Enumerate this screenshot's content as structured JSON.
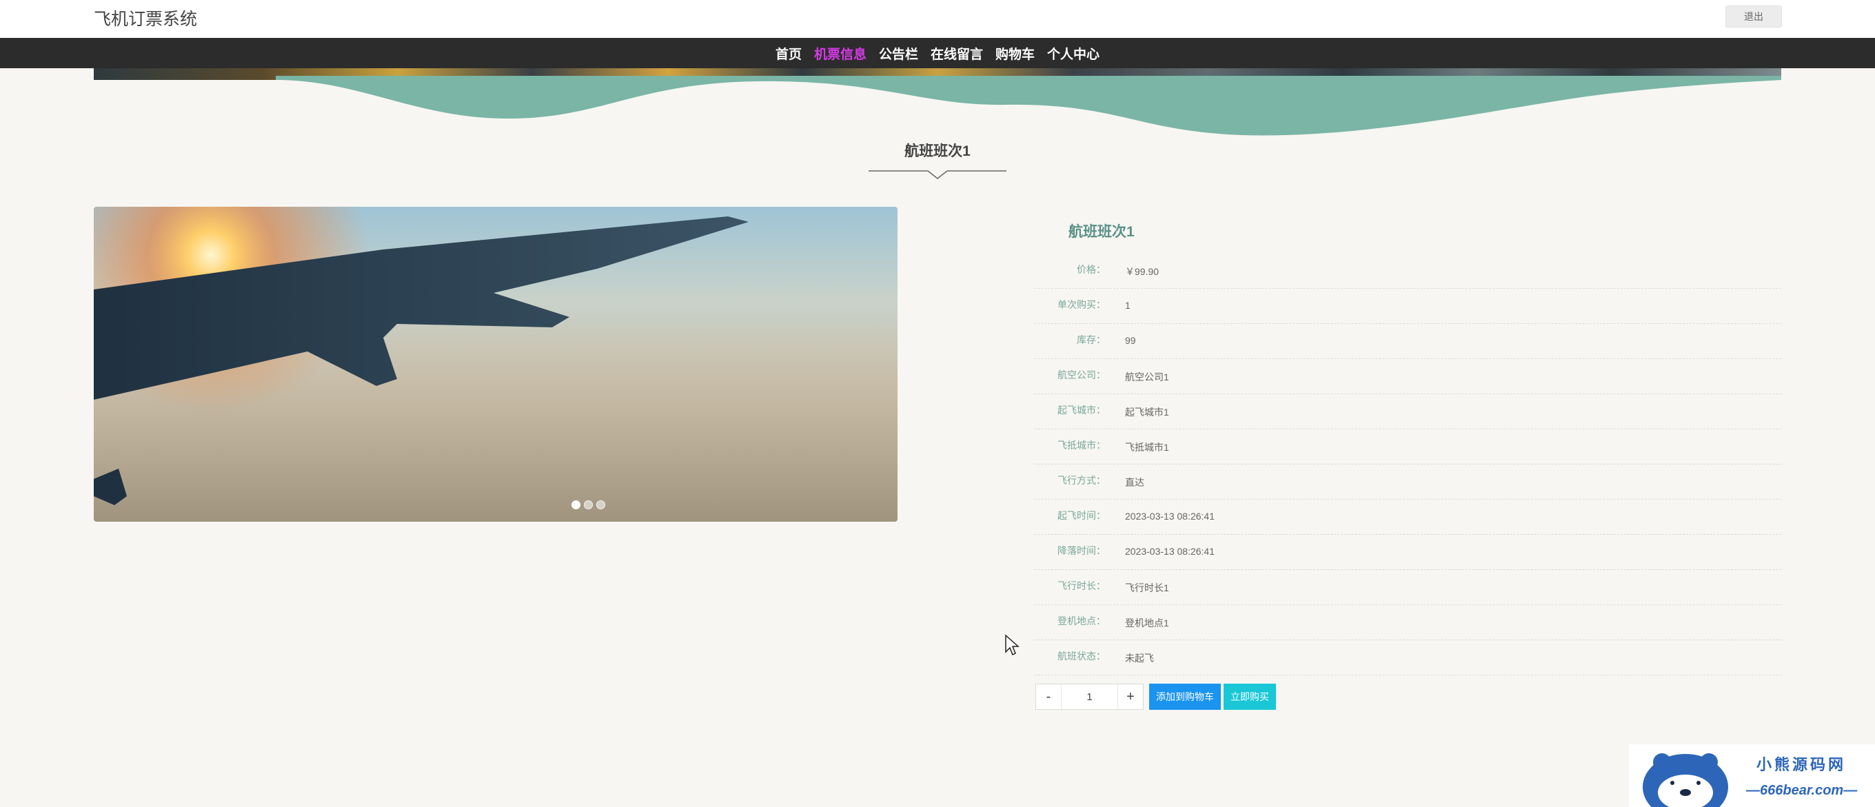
{
  "header": {
    "site_title": "飞机订票系统",
    "logout_label": "退出"
  },
  "nav": {
    "items": [
      {
        "label": "首页"
      },
      {
        "label": "机票信息",
        "active": true
      },
      {
        "label": "公告栏"
      },
      {
        "label": "在线留言"
      },
      {
        "label": "购物车"
      },
      {
        "label": "个人中心"
      }
    ]
  },
  "section": {
    "title": "航班班次1"
  },
  "carousel": {
    "slide_count": 3,
    "active_index": 0
  },
  "detail": {
    "name": "航班班次1",
    "fields": [
      {
        "label": "价格：",
        "value": "￥99.90"
      },
      {
        "label": "单次购买：",
        "value": "1"
      },
      {
        "label": "库存：",
        "value": "99"
      },
      {
        "label": "航空公司：",
        "value": "航空公司1"
      },
      {
        "label": "起飞城市：",
        "value": "起飞城市1"
      },
      {
        "label": "飞抵城市：",
        "value": "飞抵城市1"
      },
      {
        "label": "飞行方式：",
        "value": "直达"
      },
      {
        "label": "起飞时间：",
        "value": "2023-03-13 08:26:41"
      },
      {
        "label": "降落时间：",
        "value": "2023-03-13 08:26:41"
      },
      {
        "label": "飞行时长：",
        "value": "飞行时长1"
      },
      {
        "label": "登机地点：",
        "value": "登机地点1"
      },
      {
        "label": "航班状态：",
        "value": "未起飞"
      }
    ]
  },
  "actions": {
    "minus": "-",
    "quantity": "1",
    "plus": "+",
    "add_to_cart": "添加到购物车",
    "buy_now": "立即购买"
  },
  "watermark": {
    "name": "小熊源码网",
    "url": "—666bear.com—"
  },
  "colors": {
    "navbar": "#2c2c2c",
    "nav_active": "#d63ae6",
    "wave": "#7ab5a6",
    "label": "#7aa79c",
    "add_to_cart": "#1a94ef",
    "buy_now": "#19c7d6"
  }
}
